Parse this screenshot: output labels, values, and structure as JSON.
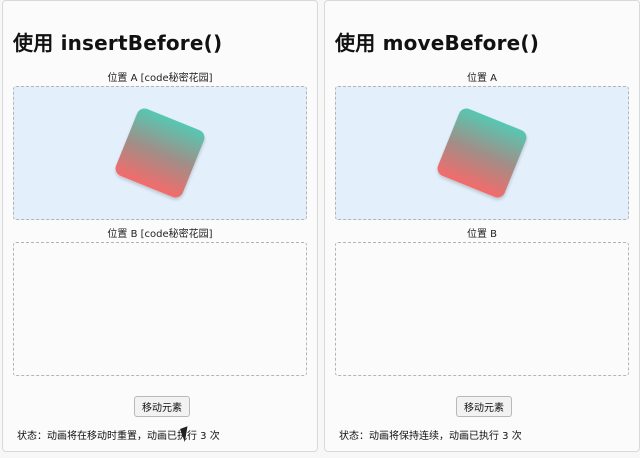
{
  "left_panel": {
    "title": "使用 insertBefore()",
    "label_a": "位置 A [code秘密花园]",
    "label_b": "位置 B [code秘密花园]",
    "button_label": "移动元素",
    "status": "状态：动画将在移动时重置，动画已执行 3 次"
  },
  "right_panel": {
    "title": "使用 moveBefore()",
    "label_a": "位置 A",
    "label_b": "位置 B",
    "button_label": "移动元素",
    "status": "状态：动画将保持连续，动画已执行 3 次"
  },
  "colors": {
    "zone_a_background": "#e3f0fc",
    "box_gradient_top": "#56c8b3",
    "box_gradient_bottom": "#f46b6b"
  },
  "icons": [
    "mouse-cursor-icon"
  ]
}
